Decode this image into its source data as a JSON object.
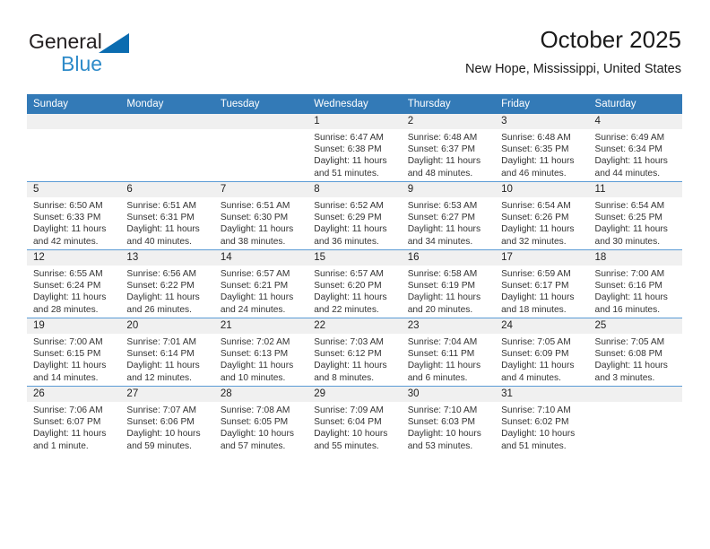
{
  "brand": {
    "name_dark": "General",
    "name_blue": "Blue",
    "accent_color": "#0b6cb0",
    "triangle_icon": "triangle-icon"
  },
  "header": {
    "title": "October 2025",
    "subtitle": "New Hope, Mississippi, United States"
  },
  "theme": {
    "header_bg": "#337ab7",
    "header_text": "#ffffff",
    "daynum_band_bg": "#f0f0f0",
    "row_border": "#5b9bd5",
    "body_bg": "#ffffff"
  },
  "weekday_headers": [
    "Sunday",
    "Monday",
    "Tuesday",
    "Wednesday",
    "Thursday",
    "Friday",
    "Saturday"
  ],
  "labels": {
    "sunrise": "Sunrise:",
    "sunset": "Sunset:",
    "daylight": "Daylight:"
  },
  "weeks": [
    [
      {
        "empty": true,
        "day": "",
        "sunrise": "",
        "sunset": "",
        "daylight_1": "",
        "daylight_2": ""
      },
      {
        "empty": true,
        "day": "",
        "sunrise": "",
        "sunset": "",
        "daylight_1": "",
        "daylight_2": ""
      },
      {
        "empty": true,
        "day": "",
        "sunrise": "",
        "sunset": "",
        "daylight_1": "",
        "daylight_2": ""
      },
      {
        "empty": false,
        "day": "1",
        "sunrise": "Sunrise: 6:47 AM",
        "sunset": "Sunset: 6:38 PM",
        "daylight_1": "Daylight: 11 hours",
        "daylight_2": "and 51 minutes."
      },
      {
        "empty": false,
        "day": "2",
        "sunrise": "Sunrise: 6:48 AM",
        "sunset": "Sunset: 6:37 PM",
        "daylight_1": "Daylight: 11 hours",
        "daylight_2": "and 48 minutes."
      },
      {
        "empty": false,
        "day": "3",
        "sunrise": "Sunrise: 6:48 AM",
        "sunset": "Sunset: 6:35 PM",
        "daylight_1": "Daylight: 11 hours",
        "daylight_2": "and 46 minutes."
      },
      {
        "empty": false,
        "day": "4",
        "sunrise": "Sunrise: 6:49 AM",
        "sunset": "Sunset: 6:34 PM",
        "daylight_1": "Daylight: 11 hours",
        "daylight_2": "and 44 minutes."
      }
    ],
    [
      {
        "empty": false,
        "day": "5",
        "sunrise": "Sunrise: 6:50 AM",
        "sunset": "Sunset: 6:33 PM",
        "daylight_1": "Daylight: 11 hours",
        "daylight_2": "and 42 minutes."
      },
      {
        "empty": false,
        "day": "6",
        "sunrise": "Sunrise: 6:51 AM",
        "sunset": "Sunset: 6:31 PM",
        "daylight_1": "Daylight: 11 hours",
        "daylight_2": "and 40 minutes."
      },
      {
        "empty": false,
        "day": "7",
        "sunrise": "Sunrise: 6:51 AM",
        "sunset": "Sunset: 6:30 PM",
        "daylight_1": "Daylight: 11 hours",
        "daylight_2": "and 38 minutes."
      },
      {
        "empty": false,
        "day": "8",
        "sunrise": "Sunrise: 6:52 AM",
        "sunset": "Sunset: 6:29 PM",
        "daylight_1": "Daylight: 11 hours",
        "daylight_2": "and 36 minutes."
      },
      {
        "empty": false,
        "day": "9",
        "sunrise": "Sunrise: 6:53 AM",
        "sunset": "Sunset: 6:27 PM",
        "daylight_1": "Daylight: 11 hours",
        "daylight_2": "and 34 minutes."
      },
      {
        "empty": false,
        "day": "10",
        "sunrise": "Sunrise: 6:54 AM",
        "sunset": "Sunset: 6:26 PM",
        "daylight_1": "Daylight: 11 hours",
        "daylight_2": "and 32 minutes."
      },
      {
        "empty": false,
        "day": "11",
        "sunrise": "Sunrise: 6:54 AM",
        "sunset": "Sunset: 6:25 PM",
        "daylight_1": "Daylight: 11 hours",
        "daylight_2": "and 30 minutes."
      }
    ],
    [
      {
        "empty": false,
        "day": "12",
        "sunrise": "Sunrise: 6:55 AM",
        "sunset": "Sunset: 6:24 PM",
        "daylight_1": "Daylight: 11 hours",
        "daylight_2": "and 28 minutes."
      },
      {
        "empty": false,
        "day": "13",
        "sunrise": "Sunrise: 6:56 AM",
        "sunset": "Sunset: 6:22 PM",
        "daylight_1": "Daylight: 11 hours",
        "daylight_2": "and 26 minutes."
      },
      {
        "empty": false,
        "day": "14",
        "sunrise": "Sunrise: 6:57 AM",
        "sunset": "Sunset: 6:21 PM",
        "daylight_1": "Daylight: 11 hours",
        "daylight_2": "and 24 minutes."
      },
      {
        "empty": false,
        "day": "15",
        "sunrise": "Sunrise: 6:57 AM",
        "sunset": "Sunset: 6:20 PM",
        "daylight_1": "Daylight: 11 hours",
        "daylight_2": "and 22 minutes."
      },
      {
        "empty": false,
        "day": "16",
        "sunrise": "Sunrise: 6:58 AM",
        "sunset": "Sunset: 6:19 PM",
        "daylight_1": "Daylight: 11 hours",
        "daylight_2": "and 20 minutes."
      },
      {
        "empty": false,
        "day": "17",
        "sunrise": "Sunrise: 6:59 AM",
        "sunset": "Sunset: 6:17 PM",
        "daylight_1": "Daylight: 11 hours",
        "daylight_2": "and 18 minutes."
      },
      {
        "empty": false,
        "day": "18",
        "sunrise": "Sunrise: 7:00 AM",
        "sunset": "Sunset: 6:16 PM",
        "daylight_1": "Daylight: 11 hours",
        "daylight_2": "and 16 minutes."
      }
    ],
    [
      {
        "empty": false,
        "day": "19",
        "sunrise": "Sunrise: 7:00 AM",
        "sunset": "Sunset: 6:15 PM",
        "daylight_1": "Daylight: 11 hours",
        "daylight_2": "and 14 minutes."
      },
      {
        "empty": false,
        "day": "20",
        "sunrise": "Sunrise: 7:01 AM",
        "sunset": "Sunset: 6:14 PM",
        "daylight_1": "Daylight: 11 hours",
        "daylight_2": "and 12 minutes."
      },
      {
        "empty": false,
        "day": "21",
        "sunrise": "Sunrise: 7:02 AM",
        "sunset": "Sunset: 6:13 PM",
        "daylight_1": "Daylight: 11 hours",
        "daylight_2": "and 10 minutes."
      },
      {
        "empty": false,
        "day": "22",
        "sunrise": "Sunrise: 7:03 AM",
        "sunset": "Sunset: 6:12 PM",
        "daylight_1": "Daylight: 11 hours",
        "daylight_2": "and 8 minutes."
      },
      {
        "empty": false,
        "day": "23",
        "sunrise": "Sunrise: 7:04 AM",
        "sunset": "Sunset: 6:11 PM",
        "daylight_1": "Daylight: 11 hours",
        "daylight_2": "and 6 minutes."
      },
      {
        "empty": false,
        "day": "24",
        "sunrise": "Sunrise: 7:05 AM",
        "sunset": "Sunset: 6:09 PM",
        "daylight_1": "Daylight: 11 hours",
        "daylight_2": "and 4 minutes."
      },
      {
        "empty": false,
        "day": "25",
        "sunrise": "Sunrise: 7:05 AM",
        "sunset": "Sunset: 6:08 PM",
        "daylight_1": "Daylight: 11 hours",
        "daylight_2": "and 3 minutes."
      }
    ],
    [
      {
        "empty": false,
        "day": "26",
        "sunrise": "Sunrise: 7:06 AM",
        "sunset": "Sunset: 6:07 PM",
        "daylight_1": "Daylight: 11 hours",
        "daylight_2": "and 1 minute."
      },
      {
        "empty": false,
        "day": "27",
        "sunrise": "Sunrise: 7:07 AM",
        "sunset": "Sunset: 6:06 PM",
        "daylight_1": "Daylight: 10 hours",
        "daylight_2": "and 59 minutes."
      },
      {
        "empty": false,
        "day": "28",
        "sunrise": "Sunrise: 7:08 AM",
        "sunset": "Sunset: 6:05 PM",
        "daylight_1": "Daylight: 10 hours",
        "daylight_2": "and 57 minutes."
      },
      {
        "empty": false,
        "day": "29",
        "sunrise": "Sunrise: 7:09 AM",
        "sunset": "Sunset: 6:04 PM",
        "daylight_1": "Daylight: 10 hours",
        "daylight_2": "and 55 minutes."
      },
      {
        "empty": false,
        "day": "30",
        "sunrise": "Sunrise: 7:10 AM",
        "sunset": "Sunset: 6:03 PM",
        "daylight_1": "Daylight: 10 hours",
        "daylight_2": "and 53 minutes."
      },
      {
        "empty": false,
        "day": "31",
        "sunrise": "Sunrise: 7:10 AM",
        "sunset": "Sunset: 6:02 PM",
        "daylight_1": "Daylight: 10 hours",
        "daylight_2": "and 51 minutes."
      },
      {
        "empty": true,
        "day": "",
        "sunrise": "",
        "sunset": "",
        "daylight_1": "",
        "daylight_2": ""
      }
    ]
  ]
}
